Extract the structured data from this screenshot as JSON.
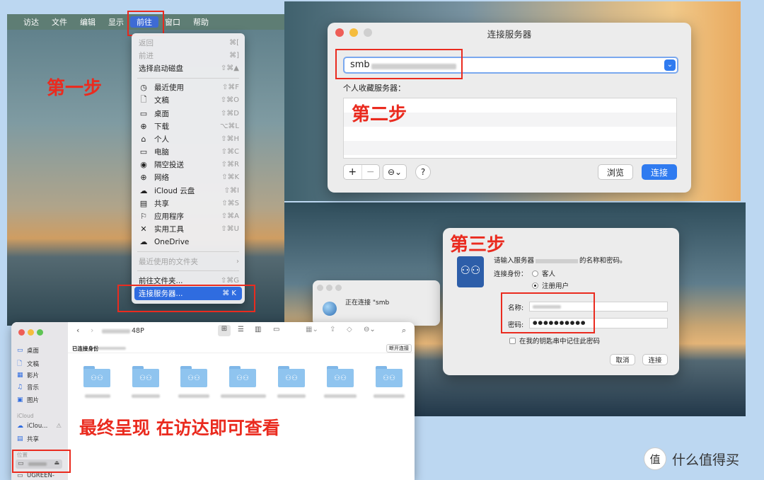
{
  "menubar": {
    "items": [
      "访达",
      "文件",
      "编辑",
      "显示",
      "前往",
      "窗口",
      "帮助"
    ]
  },
  "go_menu": {
    "items": [
      {
        "icon": "",
        "label": "返回",
        "shortcut": "⌘[",
        "disabled": true
      },
      {
        "icon": "",
        "label": "前进",
        "shortcut": "⌘]",
        "disabled": true
      },
      {
        "icon": "",
        "label": "选择启动磁盘",
        "shortcut": "⇧⌘▲",
        "disabled": false
      },
      {
        "icon": "◷",
        "label": "最近使用",
        "shortcut": "⇧⌘F",
        "disabled": false
      },
      {
        "icon": "🗋",
        "label": "文稿",
        "shortcut": "⇧⌘O",
        "disabled": false
      },
      {
        "icon": "▭",
        "label": "桌面",
        "shortcut": "⇧⌘D",
        "disabled": false
      },
      {
        "icon": "⊕",
        "label": "下载",
        "shortcut": "⌥⌘L",
        "disabled": false
      },
      {
        "icon": "⌂",
        "label": "个人",
        "shortcut": "⇧⌘H",
        "disabled": false
      },
      {
        "icon": "▭",
        "label": "电脑",
        "shortcut": "⇧⌘C",
        "disabled": false
      },
      {
        "icon": "◉",
        "label": "隔空投送",
        "shortcut": "⇧⌘R",
        "disabled": false
      },
      {
        "icon": "⊕",
        "label": "网络",
        "shortcut": "⇧⌘K",
        "disabled": false
      },
      {
        "icon": "☁",
        "label": "iCloud 云盘",
        "shortcut": "⇧⌘I",
        "disabled": false
      },
      {
        "icon": "▤",
        "label": "共享",
        "shortcut": "⇧⌘S",
        "disabled": false
      },
      {
        "icon": "⚐",
        "label": "应用程序",
        "shortcut": "⇧⌘A",
        "disabled": false
      },
      {
        "icon": "✕",
        "label": "实用工具",
        "shortcut": "⇧⌘U",
        "disabled": false
      },
      {
        "icon": "☁",
        "label": "OneDrive",
        "shortcut": "",
        "disabled": false
      }
    ],
    "recent_folders": "最近使用的文件夹",
    "go_to_folder": "前往文件夹...",
    "go_to_folder_shortcut": "⇧⌘G",
    "connect_server": "连接服务器...",
    "connect_server_shortcut": "⌘ K"
  },
  "steps": {
    "one": "第一步",
    "two": "第二步",
    "three": "第三步",
    "final": "最终呈现  在访达即可查看"
  },
  "connect_dialog": {
    "title": "连接服务器",
    "address_value": "smb",
    "favorites_label": "个人收藏服务器：",
    "plus": "+",
    "minus": "−",
    "more": "⊖⌄",
    "help": "?",
    "browse": "浏览",
    "connect": "连接"
  },
  "connecting_window": {
    "text": "正在连接 \"smb"
  },
  "auth_dialog": {
    "prompt_prefix": "请输入服务器",
    "prompt_suffix": "的名称和密码。",
    "connect_as": "连接身份：",
    "guest": "客人",
    "registered": "注册用户",
    "name_label": "名称:",
    "password_label": "密码:",
    "password_dots": "●●●●●●●●●●",
    "remember": "在我的钥匙串中记住此密码",
    "cancel": "取消",
    "connect": "连接"
  },
  "finder": {
    "path_suffix": "48P",
    "connected_as": "已连接身份",
    "disconnect": "断开连接",
    "sidebar": {
      "items": [
        {
          "icon": "▭",
          "label": "桌面"
        },
        {
          "icon": "🗋",
          "label": "文稿"
        },
        {
          "icon": "▦",
          "label": "影片"
        },
        {
          "icon": "♫",
          "label": "音乐"
        },
        {
          "icon": "▣",
          "label": "图片"
        }
      ],
      "icloud_header": "iCloud",
      "icloud_item": "iClou...",
      "shared_item": "共享",
      "location_header": "位置",
      "ugreen": "UGREEN-"
    }
  },
  "watermark": {
    "badge": "值",
    "text": "什么值得买"
  }
}
